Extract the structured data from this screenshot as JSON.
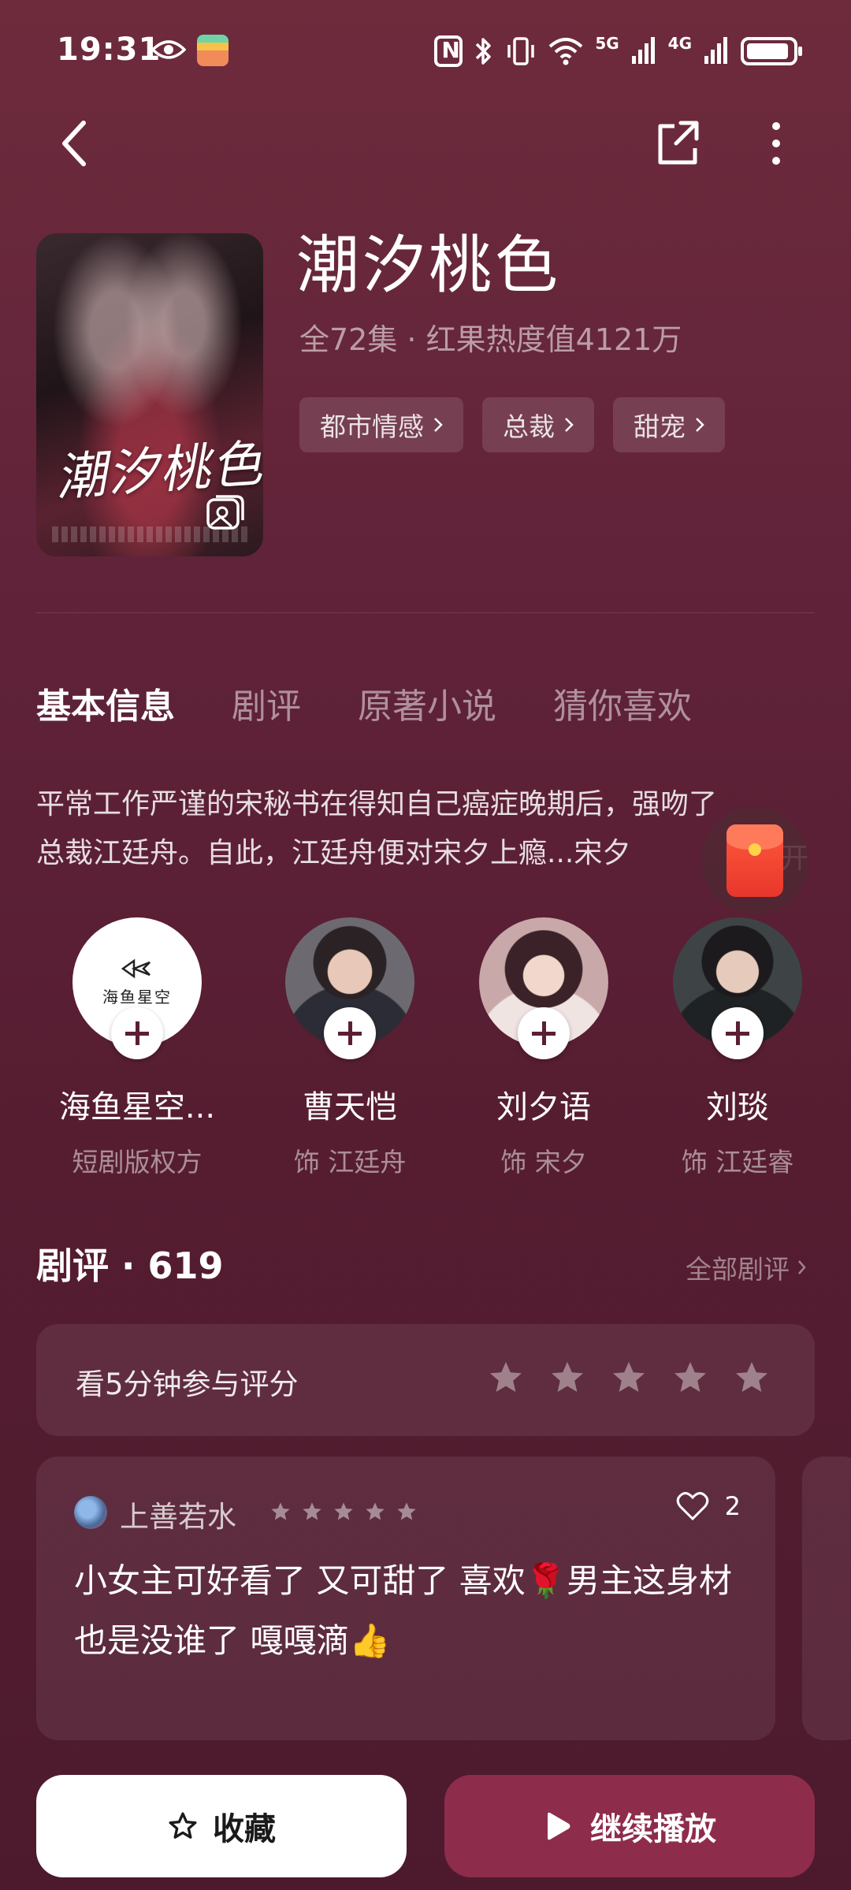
{
  "status_bar": {
    "time": "19:31",
    "network_5g": "5G",
    "network_4g": "4G"
  },
  "drama": {
    "title": "潮汐桃色",
    "meta": "全72集 · 红果热度值4121万",
    "poster_title": "潮汐桃色",
    "tags": [
      "都市情感",
      "总裁",
      "甜宠"
    ]
  },
  "tabs": [
    "基本信息",
    "剧评",
    "原著小说",
    "猜你喜欢"
  ],
  "synopsis": {
    "line1": "平常工作严谨的宋秘书在得知自己癌症晚期后，强吻了",
    "line2": "总裁江廷舟。自此，江廷舟便对宋夕上瘾...宋夕",
    "expand": "开"
  },
  "cast": [
    {
      "name": "海鱼星空...",
      "role": "短剧版权方",
      "logo_text": "海鱼星空"
    },
    {
      "name": "曹天恺",
      "role": "饰 江廷舟"
    },
    {
      "name": "刘夕语",
      "role": "饰 宋夕"
    },
    {
      "name": "刘琰",
      "role": "饰 江廷睿"
    }
  ],
  "reviews": {
    "header": "剧评 · 619",
    "all_label": "全部剧评",
    "rate_prompt": "看5分钟参与评分",
    "items": [
      {
        "user": "上善若水",
        "likes": "2",
        "text": "小女主可好看了 又可甜了 喜欢🌹男主这身材也是没谁了 嘎嘎滴👍"
      }
    ]
  },
  "actions": {
    "collect": "收藏",
    "play": "继续播放"
  },
  "colors": {
    "accent": "#8e2c4c",
    "background": "#5c2034"
  }
}
